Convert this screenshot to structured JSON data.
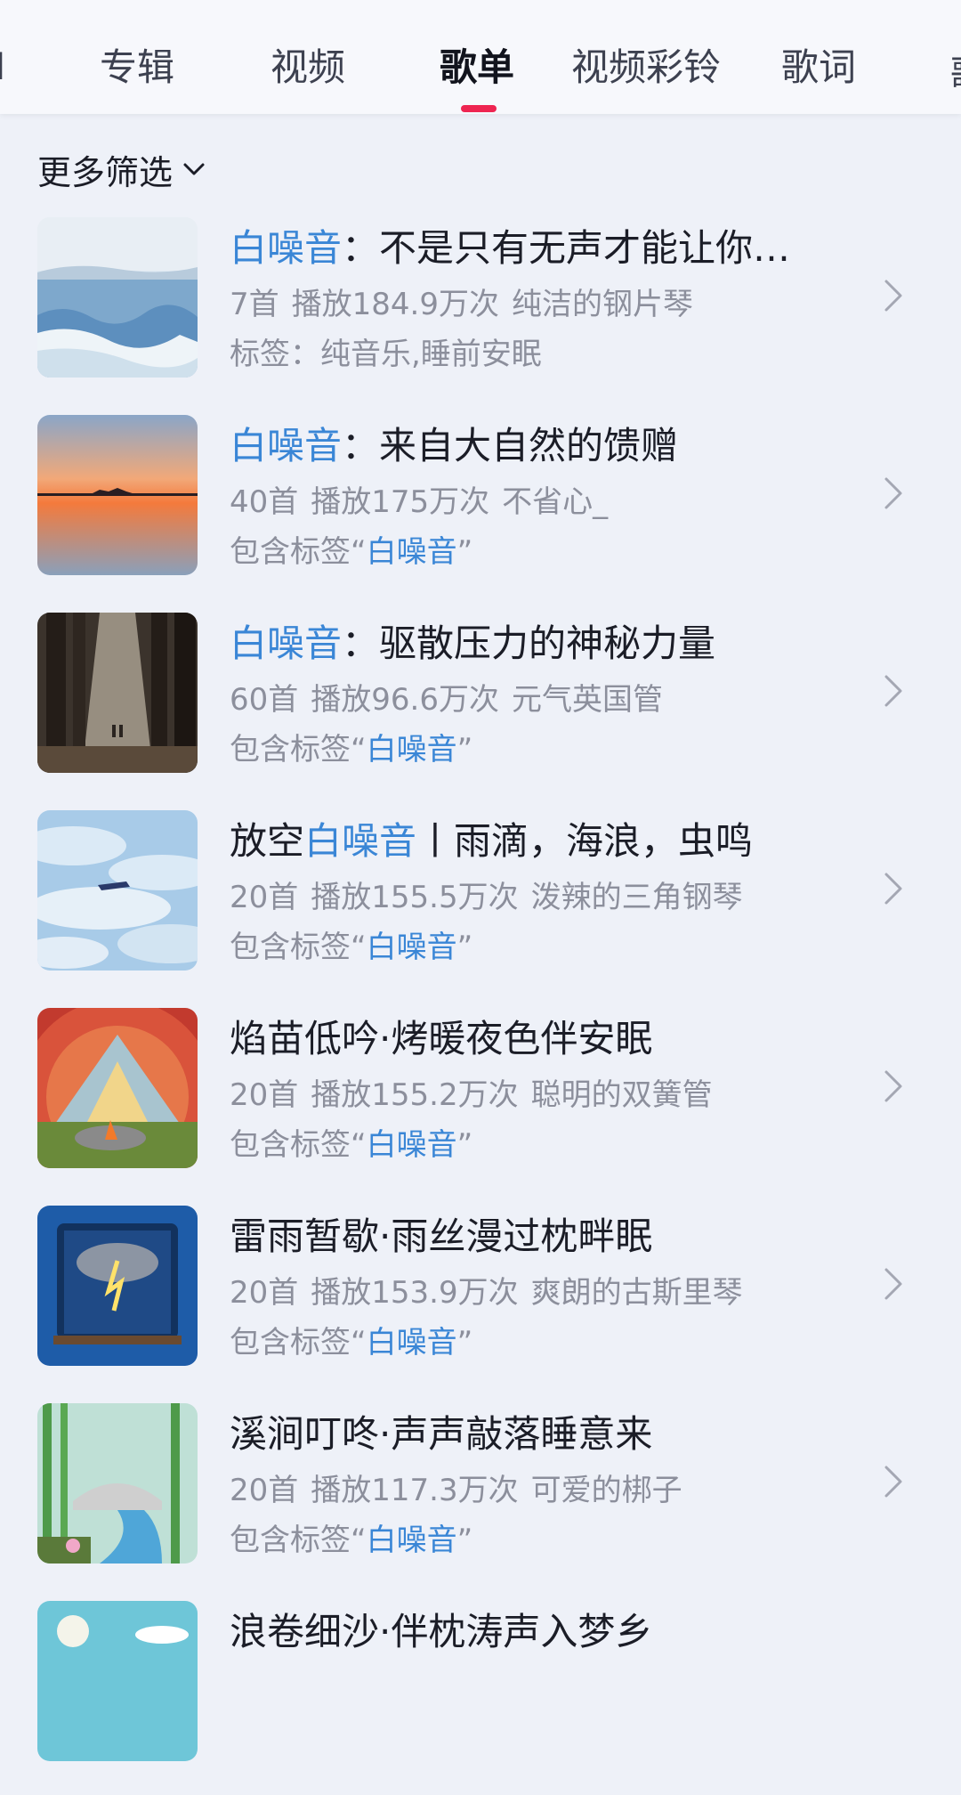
{
  "tabs": {
    "left_partial": "I",
    "album": "专辑",
    "video": "视频",
    "playlist": "歌单",
    "video_ringtone": "视频彩铃",
    "lyrics": "歌词",
    "right_partial": "歌"
  },
  "filter": {
    "label": "更多筛选"
  },
  "highlight_color": "#3a86d6",
  "accent_color": "#ee2551",
  "playlists": [
    {
      "title_hl": "白噪音",
      "title_rest": "：不是只有无声才能让你…",
      "count": "7首",
      "plays": "播放184.9万次",
      "creator": "纯洁的钢片琴",
      "tag_prefix": "标签：纯音乐,睡前安眠",
      "tag_hl": "",
      "tag_suffix": "",
      "cover": "ocean-waves"
    },
    {
      "title_hl": "白噪音",
      "title_rest": "：来自大自然的馈赠",
      "count": "40首",
      "plays": "播放175万次",
      "creator": "不省心_",
      "tag_prefix": "包含标签“",
      "tag_hl": "白噪音",
      "tag_suffix": "”",
      "cover": "sunset-lake"
    },
    {
      "title_hl": "白噪音",
      "title_rest": "：驱散压力的神秘力量",
      "count": "60首",
      "plays": "播放96.6万次",
      "creator": "元气英国管",
      "tag_prefix": "包含标签“",
      "tag_hl": "白噪音",
      "tag_suffix": "”",
      "cover": "forest-light"
    },
    {
      "title_pre": "放空",
      "title_hl": "白噪音",
      "title_rest": "丨雨滴，海浪，虫鸣",
      "count": "20首",
      "plays": "播放155.5万次",
      "creator": "泼辣的三角钢琴",
      "tag_prefix": "包含标签“",
      "tag_hl": "白噪音",
      "tag_suffix": "”",
      "cover": "clouds-sky"
    },
    {
      "title_hl": "",
      "title_rest": "焰苗低吟·烤暖夜色伴安眠",
      "count": "20首",
      "plays": "播放155.2万次",
      "creator": "聪明的双簧管",
      "tag_prefix": "包含标签“",
      "tag_hl": "白噪音",
      "tag_suffix": "”",
      "cover": "campfire"
    },
    {
      "title_hl": "",
      "title_rest": "雷雨暂歇·雨丝漫过枕畔眠",
      "count": "20首",
      "plays": "播放153.9万次",
      "creator": "爽朗的古斯里琴",
      "tag_prefix": "包含标签“",
      "tag_hl": "白噪音",
      "tag_suffix": "”",
      "cover": "thunderstorm-window"
    },
    {
      "title_hl": "",
      "title_rest": "溪涧叮咚·声声敲落睡意来",
      "count": "20首",
      "plays": "播放117.3万次",
      "creator": "可爱的梆子",
      "tag_prefix": "包含标签“",
      "tag_hl": "白噪音",
      "tag_suffix": "”",
      "cover": "bamboo-stream"
    },
    {
      "title_hl": "",
      "title_rest": "浪卷细沙·伴枕涛声入梦乡",
      "count": "",
      "plays": "",
      "creator": "",
      "tag_prefix": "",
      "tag_hl": "",
      "tag_suffix": "",
      "cover": "beach-sky"
    }
  ]
}
